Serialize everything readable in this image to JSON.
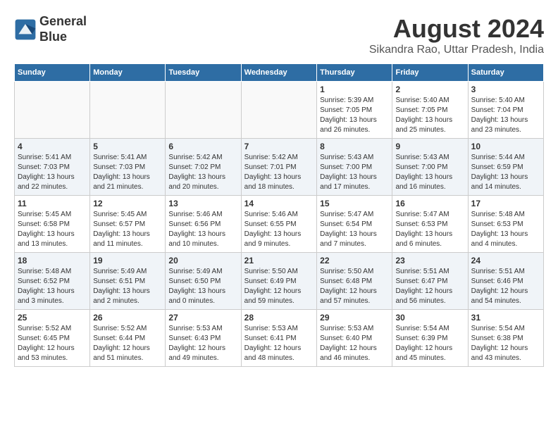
{
  "header": {
    "logo_line1": "General",
    "logo_line2": "Blue",
    "month_year": "August 2024",
    "location": "Sikandra Rao, Uttar Pradesh, India"
  },
  "days_of_week": [
    "Sunday",
    "Monday",
    "Tuesday",
    "Wednesday",
    "Thursday",
    "Friday",
    "Saturday"
  ],
  "weeks": [
    [
      {
        "day": "",
        "info": ""
      },
      {
        "day": "",
        "info": ""
      },
      {
        "day": "",
        "info": ""
      },
      {
        "day": "",
        "info": ""
      },
      {
        "day": "1",
        "info": "Sunrise: 5:39 AM\nSunset: 7:05 PM\nDaylight: 13 hours and 26 minutes."
      },
      {
        "day": "2",
        "info": "Sunrise: 5:40 AM\nSunset: 7:05 PM\nDaylight: 13 hours and 25 minutes."
      },
      {
        "day": "3",
        "info": "Sunrise: 5:40 AM\nSunset: 7:04 PM\nDaylight: 13 hours and 23 minutes."
      }
    ],
    [
      {
        "day": "4",
        "info": "Sunrise: 5:41 AM\nSunset: 7:03 PM\nDaylight: 13 hours and 22 minutes."
      },
      {
        "day": "5",
        "info": "Sunrise: 5:41 AM\nSunset: 7:03 PM\nDaylight: 13 hours and 21 minutes."
      },
      {
        "day": "6",
        "info": "Sunrise: 5:42 AM\nSunset: 7:02 PM\nDaylight: 13 hours and 20 minutes."
      },
      {
        "day": "7",
        "info": "Sunrise: 5:42 AM\nSunset: 7:01 PM\nDaylight: 13 hours and 18 minutes."
      },
      {
        "day": "8",
        "info": "Sunrise: 5:43 AM\nSunset: 7:00 PM\nDaylight: 13 hours and 17 minutes."
      },
      {
        "day": "9",
        "info": "Sunrise: 5:43 AM\nSunset: 7:00 PM\nDaylight: 13 hours and 16 minutes."
      },
      {
        "day": "10",
        "info": "Sunrise: 5:44 AM\nSunset: 6:59 PM\nDaylight: 13 hours and 14 minutes."
      }
    ],
    [
      {
        "day": "11",
        "info": "Sunrise: 5:45 AM\nSunset: 6:58 PM\nDaylight: 13 hours and 13 minutes."
      },
      {
        "day": "12",
        "info": "Sunrise: 5:45 AM\nSunset: 6:57 PM\nDaylight: 13 hours and 11 minutes."
      },
      {
        "day": "13",
        "info": "Sunrise: 5:46 AM\nSunset: 6:56 PM\nDaylight: 13 hours and 10 minutes."
      },
      {
        "day": "14",
        "info": "Sunrise: 5:46 AM\nSunset: 6:55 PM\nDaylight: 13 hours and 9 minutes."
      },
      {
        "day": "15",
        "info": "Sunrise: 5:47 AM\nSunset: 6:54 PM\nDaylight: 13 hours and 7 minutes."
      },
      {
        "day": "16",
        "info": "Sunrise: 5:47 AM\nSunset: 6:53 PM\nDaylight: 13 hours and 6 minutes."
      },
      {
        "day": "17",
        "info": "Sunrise: 5:48 AM\nSunset: 6:53 PM\nDaylight: 13 hours and 4 minutes."
      }
    ],
    [
      {
        "day": "18",
        "info": "Sunrise: 5:48 AM\nSunset: 6:52 PM\nDaylight: 13 hours and 3 minutes."
      },
      {
        "day": "19",
        "info": "Sunrise: 5:49 AM\nSunset: 6:51 PM\nDaylight: 13 hours and 2 minutes."
      },
      {
        "day": "20",
        "info": "Sunrise: 5:49 AM\nSunset: 6:50 PM\nDaylight: 13 hours and 0 minutes."
      },
      {
        "day": "21",
        "info": "Sunrise: 5:50 AM\nSunset: 6:49 PM\nDaylight: 12 hours and 59 minutes."
      },
      {
        "day": "22",
        "info": "Sunrise: 5:50 AM\nSunset: 6:48 PM\nDaylight: 12 hours and 57 minutes."
      },
      {
        "day": "23",
        "info": "Sunrise: 5:51 AM\nSunset: 6:47 PM\nDaylight: 12 hours and 56 minutes."
      },
      {
        "day": "24",
        "info": "Sunrise: 5:51 AM\nSunset: 6:46 PM\nDaylight: 12 hours and 54 minutes."
      }
    ],
    [
      {
        "day": "25",
        "info": "Sunrise: 5:52 AM\nSunset: 6:45 PM\nDaylight: 12 hours and 53 minutes."
      },
      {
        "day": "26",
        "info": "Sunrise: 5:52 AM\nSunset: 6:44 PM\nDaylight: 12 hours and 51 minutes."
      },
      {
        "day": "27",
        "info": "Sunrise: 5:53 AM\nSunset: 6:43 PM\nDaylight: 12 hours and 49 minutes."
      },
      {
        "day": "28",
        "info": "Sunrise: 5:53 AM\nSunset: 6:41 PM\nDaylight: 12 hours and 48 minutes."
      },
      {
        "day": "29",
        "info": "Sunrise: 5:53 AM\nSunset: 6:40 PM\nDaylight: 12 hours and 46 minutes."
      },
      {
        "day": "30",
        "info": "Sunrise: 5:54 AM\nSunset: 6:39 PM\nDaylight: 12 hours and 45 minutes."
      },
      {
        "day": "31",
        "info": "Sunrise: 5:54 AM\nSunset: 6:38 PM\nDaylight: 12 hours and 43 minutes."
      }
    ]
  ]
}
